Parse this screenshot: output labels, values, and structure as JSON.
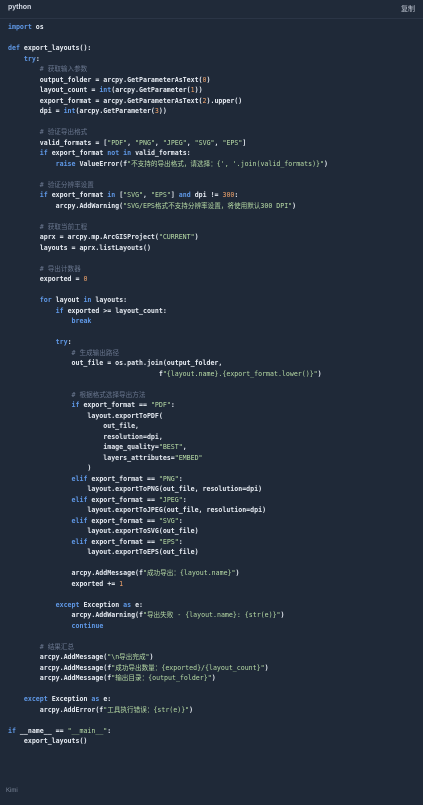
{
  "header": {
    "language": "python",
    "copy_label": "复制"
  },
  "footer": {
    "badge": "Kimi"
  },
  "code": {
    "lines": [
      [
        [
          "kw",
          "import"
        ],
        [
          "t",
          " os"
        ]
      ],
      [],
      [
        [
          "kw",
          "def"
        ],
        [
          "t",
          " export_layouts():"
        ]
      ],
      [
        [
          "t",
          "    "
        ],
        [
          "kw",
          "try"
        ],
        [
          "t",
          ":"
        ]
      ],
      [
        [
          "t",
          "        "
        ],
        [
          "cm",
          "# 获取输入参数"
        ]
      ],
      [
        [
          "t",
          "        output_folder = arcpy.GetParameterAsText("
        ],
        [
          "num",
          "0"
        ],
        [
          "t",
          ")"
        ]
      ],
      [
        [
          "t",
          "        layout_count = "
        ],
        [
          "kw",
          "int"
        ],
        [
          "t",
          "(arcpy.GetParameter("
        ],
        [
          "num",
          "1"
        ],
        [
          "t",
          "))"
        ]
      ],
      [
        [
          "t",
          "        export_format = arcpy.GetParameterAsText("
        ],
        [
          "num",
          "2"
        ],
        [
          "t",
          ").upper()"
        ]
      ],
      [
        [
          "t",
          "        dpi = "
        ],
        [
          "kw",
          "int"
        ],
        [
          "t",
          "(arcpy.GetParameter("
        ],
        [
          "num",
          "3"
        ],
        [
          "t",
          "))"
        ]
      ],
      [],
      [
        [
          "t",
          "        "
        ],
        [
          "cm",
          "# 验证导出格式"
        ]
      ],
      [
        [
          "t",
          "        valid_formats = ["
        ],
        [
          "str",
          "\"PDF\""
        ],
        [
          "t",
          ", "
        ],
        [
          "str",
          "\"PNG\""
        ],
        [
          "t",
          ", "
        ],
        [
          "str",
          "\"JPEG\""
        ],
        [
          "t",
          ", "
        ],
        [
          "str",
          "\"SVG\""
        ],
        [
          "t",
          ", "
        ],
        [
          "str",
          "\"EPS\""
        ],
        [
          "t",
          "]"
        ]
      ],
      [
        [
          "t",
          "        "
        ],
        [
          "kw",
          "if"
        ],
        [
          "t",
          " export_format "
        ],
        [
          "kw",
          "not in"
        ],
        [
          "t",
          " valid_formats:"
        ]
      ],
      [
        [
          "t",
          "            "
        ],
        [
          "kw",
          "raise"
        ],
        [
          "t",
          " ValueError(f"
        ],
        [
          "str",
          "\"不支持的导出格式，请选择：{', '.join(valid_formats)}\""
        ],
        [
          "t",
          ")"
        ]
      ],
      [],
      [
        [
          "t",
          "        "
        ],
        [
          "cm",
          "# 验证分辨率设置"
        ]
      ],
      [
        [
          "t",
          "        "
        ],
        [
          "kw",
          "if"
        ],
        [
          "t",
          " export_format "
        ],
        [
          "kw",
          "in"
        ],
        [
          "t",
          " ["
        ],
        [
          "str",
          "\"SVG\""
        ],
        [
          "t",
          ", "
        ],
        [
          "str",
          "\"EPS\""
        ],
        [
          "t",
          "] "
        ],
        [
          "kw",
          "and"
        ],
        [
          "t",
          " dpi != "
        ],
        [
          "num",
          "300"
        ],
        [
          "t",
          ":"
        ]
      ],
      [
        [
          "t",
          "            arcpy.AddWarning("
        ],
        [
          "str",
          "\"SVG/EPS格式不支持分辨率设置，将使用默认300 DPI\""
        ],
        [
          "t",
          ")"
        ]
      ],
      [],
      [
        [
          "t",
          "        "
        ],
        [
          "cm",
          "# 获取当前工程"
        ]
      ],
      [
        [
          "t",
          "        aprx = arcpy.mp.ArcGISProject("
        ],
        [
          "str",
          "\"CURRENT\""
        ],
        [
          "t",
          ")"
        ]
      ],
      [
        [
          "t",
          "        layouts = aprx.listLayouts()"
        ]
      ],
      [],
      [
        [
          "t",
          "        "
        ],
        [
          "cm",
          "# 导出计数器"
        ]
      ],
      [
        [
          "t",
          "        exported = "
        ],
        [
          "num",
          "0"
        ]
      ],
      [],
      [
        [
          "t",
          "        "
        ],
        [
          "kw",
          "for"
        ],
        [
          "t",
          " layout "
        ],
        [
          "kw",
          "in"
        ],
        [
          "t",
          " layouts:"
        ]
      ],
      [
        [
          "t",
          "            "
        ],
        [
          "kw",
          "if"
        ],
        [
          "t",
          " exported >= layout_count:"
        ]
      ],
      [
        [
          "t",
          "                "
        ],
        [
          "kw",
          "break"
        ]
      ],
      [],
      [
        [
          "t",
          "            "
        ],
        [
          "kw",
          "try"
        ],
        [
          "t",
          ":"
        ]
      ],
      [
        [
          "t",
          "                "
        ],
        [
          "cm",
          "# 生成输出路径"
        ]
      ],
      [
        [
          "t",
          "                out_file = os.path.join(output_folder,"
        ]
      ],
      [
        [
          "t",
          "                                      f"
        ],
        [
          "str",
          "\"{layout.name}.{export_format.lower()}\""
        ],
        [
          "t",
          ")"
        ]
      ],
      [],
      [
        [
          "t",
          "                "
        ],
        [
          "cm",
          "# 根据格式选择导出方法"
        ]
      ],
      [
        [
          "t",
          "                "
        ],
        [
          "kw",
          "if"
        ],
        [
          "t",
          " export_format == "
        ],
        [
          "str",
          "\"PDF\""
        ],
        [
          "t",
          ":"
        ]
      ],
      [
        [
          "t",
          "                    layout.exportToPDF("
        ]
      ],
      [
        [
          "t",
          "                        out_file,"
        ]
      ],
      [
        [
          "t",
          "                        resolution=dpi,"
        ]
      ],
      [
        [
          "t",
          "                        image_quality="
        ],
        [
          "str",
          "\"BEST\""
        ],
        [
          "t",
          ","
        ]
      ],
      [
        [
          "t",
          "                        layers_attributes="
        ],
        [
          "str",
          "\"EMBED\""
        ]
      ],
      [
        [
          "t",
          "                    )"
        ]
      ],
      [
        [
          "t",
          "                "
        ],
        [
          "kw",
          "elif"
        ],
        [
          "t",
          " export_format == "
        ],
        [
          "str",
          "\"PNG\""
        ],
        [
          "t",
          ":"
        ]
      ],
      [
        [
          "t",
          "                    layout.exportToPNG(out_file, resolution=dpi)"
        ]
      ],
      [
        [
          "t",
          "                "
        ],
        [
          "kw",
          "elif"
        ],
        [
          "t",
          " export_format == "
        ],
        [
          "str",
          "\"JPEG\""
        ],
        [
          "t",
          ":"
        ]
      ],
      [
        [
          "t",
          "                    layout.exportToJPEG(out_file, resolution=dpi)"
        ]
      ],
      [
        [
          "t",
          "                "
        ],
        [
          "kw",
          "elif"
        ],
        [
          "t",
          " export_format == "
        ],
        [
          "str",
          "\"SVG\""
        ],
        [
          "t",
          ":"
        ]
      ],
      [
        [
          "t",
          "                    layout.exportToSVG(out_file)"
        ]
      ],
      [
        [
          "t",
          "                "
        ],
        [
          "kw",
          "elif"
        ],
        [
          "t",
          " export_format == "
        ],
        [
          "str",
          "\"EPS\""
        ],
        [
          "t",
          ":"
        ]
      ],
      [
        [
          "t",
          "                    layout.exportToEPS(out_file)"
        ]
      ],
      [],
      [
        [
          "t",
          "                arcpy.AddMessage(f"
        ],
        [
          "str",
          "\"成功导出：{layout.name}\""
        ],
        [
          "t",
          ")"
        ]
      ],
      [
        [
          "t",
          "                exported += "
        ],
        [
          "num",
          "1"
        ]
      ],
      [],
      [
        [
          "t",
          "            "
        ],
        [
          "kw",
          "except"
        ],
        [
          "t",
          " Exception "
        ],
        [
          "kw",
          "as"
        ],
        [
          "t",
          " e:"
        ]
      ],
      [
        [
          "t",
          "                arcpy.AddWarning(f"
        ],
        [
          "str",
          "\"导出失败 - {layout.name}: {str(e)}\""
        ],
        [
          "t",
          ")"
        ]
      ],
      [
        [
          "t",
          "                "
        ],
        [
          "kw",
          "continue"
        ]
      ],
      [],
      [
        [
          "t",
          "        "
        ],
        [
          "cm",
          "# 结果汇总"
        ]
      ],
      [
        [
          "t",
          "        arcpy.AddMessage("
        ],
        [
          "str",
          "\"\\n导出完成\""
        ],
        [
          "t",
          ")"
        ]
      ],
      [
        [
          "t",
          "        arcpy.AddMessage(f"
        ],
        [
          "str",
          "\"成功导出数量：{exported}/{layout_count}\""
        ],
        [
          "t",
          ")"
        ]
      ],
      [
        [
          "t",
          "        arcpy.AddMessage(f"
        ],
        [
          "str",
          "\"输出目录：{output_folder}\""
        ],
        [
          "t",
          ")"
        ]
      ],
      [],
      [
        [
          "t",
          "    "
        ],
        [
          "kw",
          "except"
        ],
        [
          "t",
          " Exception "
        ],
        [
          "kw",
          "as"
        ],
        [
          "t",
          " e:"
        ]
      ],
      [
        [
          "t",
          "        arcpy.AddError(f"
        ],
        [
          "str",
          "\"工具执行错误：{str(e)}\""
        ],
        [
          "t",
          ")"
        ]
      ],
      [],
      [
        [
          "kw",
          "if"
        ],
        [
          "t",
          " __name__ == "
        ],
        [
          "str",
          "\"__main__\""
        ],
        [
          "t",
          ":"
        ]
      ],
      [
        [
          "t",
          "    export_layouts()"
        ]
      ]
    ]
  }
}
